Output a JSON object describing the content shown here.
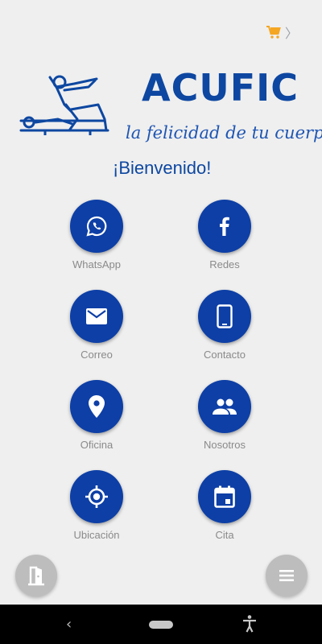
{
  "header": {
    "cart_icon": "cart-icon",
    "chevron_icon": "chevron-right-icon",
    "accent_color": "#f5a623"
  },
  "brand": {
    "name": "ACUFIC",
    "slogan": "la felicidad de tu cuerpo",
    "color": "#0d47a1"
  },
  "welcome": "¡Bienvenido!",
  "menu": [
    {
      "label": "WhatsApp",
      "icon": "whatsapp-icon"
    },
    {
      "label": "Redes",
      "icon": "facebook-icon"
    },
    {
      "label": "Correo",
      "icon": "mail-icon"
    },
    {
      "label": "Contacto",
      "icon": "phone-icon"
    },
    {
      "label": "Oficina",
      "icon": "location-pin-icon"
    },
    {
      "label": "Nosotros",
      "icon": "people-icon"
    },
    {
      "label": "Ubicación",
      "icon": "gps-target-icon"
    },
    {
      "label": "Cita",
      "icon": "calendar-icon"
    }
  ],
  "fabs": {
    "left_icon": "door-exit-icon",
    "right_icon": "hamburger-menu-icon"
  },
  "navbar": {
    "back_icon": "back-icon",
    "home_icon": "home-pill-icon",
    "accessibility_icon": "accessibility-icon"
  }
}
